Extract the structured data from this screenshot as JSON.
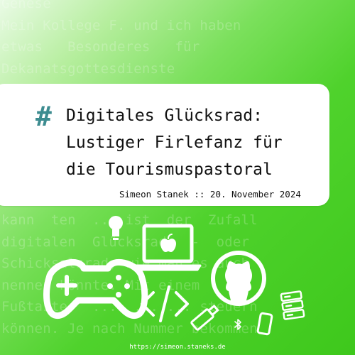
{
  "background_lines": [
    "Genese",
    "Mein Kollege F. und ich haben",
    "etwas   Besonderes   für",
    "Dekanatsgottesdienste",
    "",
    "",
    "",
    "",
    "",
    "",
    "kann  ten  ... ist  der  Zufall",
    "digitalen  Glücksrads  -  oder",
    "Schicksalsrad, wie man es auch",
    "nennen könnte. Mit einem",
    "Fußtaster  ...  ... ... steuern",
    "können. Je nach Nummer bekommen"
  ],
  "hashtag": "#",
  "title_lines": [
    "Digitales Glücksrad:",
    "Lustiger Firlefanz für",
    "die Tourismuspastoral"
  ],
  "byline": "Simeon Stanek :: 20. November 2024",
  "url": "https://simeon.staneks.de",
  "colors": {
    "accent_hash": "#3d8c90",
    "background_green": "#4fd22c",
    "card": "#ffffff",
    "icon_stroke": "#ffffff"
  },
  "icons": [
    "lightbulb-icon",
    "laptop-icon",
    "apple-logo-icon",
    "gamepad-icon",
    "github-icon",
    "code-icon",
    "usb-stick-icon",
    "bluetooth-icon",
    "phone-icon",
    "server-icon"
  ]
}
